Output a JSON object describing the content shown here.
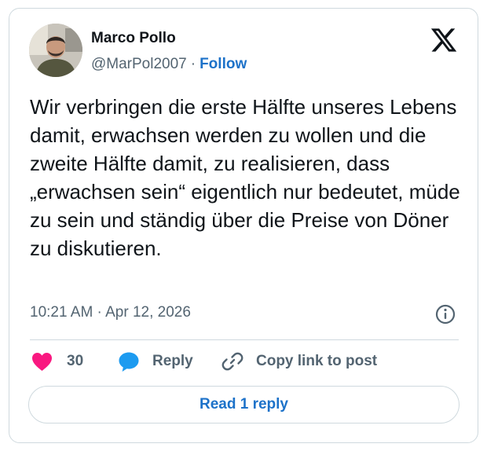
{
  "author": {
    "display_name": "Marco Pollo",
    "handle": "@MarPol2007",
    "separator": "·",
    "follow_label": "Follow"
  },
  "tweet": {
    "text": "Wir verbringen die erste Hälfte unseres Lebens damit, erwachsen werden zu wollen und die zweite Hälfte damit, zu realisieren, dass „erwachsen sein“ eigentlich nur bedeutet, müde zu sein und ständig über die Preise von Döner zu diskutieren.",
    "timestamp": "10:21 AM · Apr 12, 2026"
  },
  "actions": {
    "like_count": "30",
    "reply_label": "Reply",
    "copy_link_label": "Copy link to post"
  },
  "read_replies_label": "Read 1 reply",
  "icons": {
    "platform_logo": "x-logo-icon",
    "like": "heart-icon",
    "reply": "speech-bubble-icon",
    "copy_link": "link-icon",
    "info": "info-icon"
  },
  "colors": {
    "link_blue": "#1d72c9",
    "like_pink": "#f91880",
    "reply_blue": "#1d9bf0",
    "muted_text": "#536471",
    "border": "#cfd9de"
  }
}
